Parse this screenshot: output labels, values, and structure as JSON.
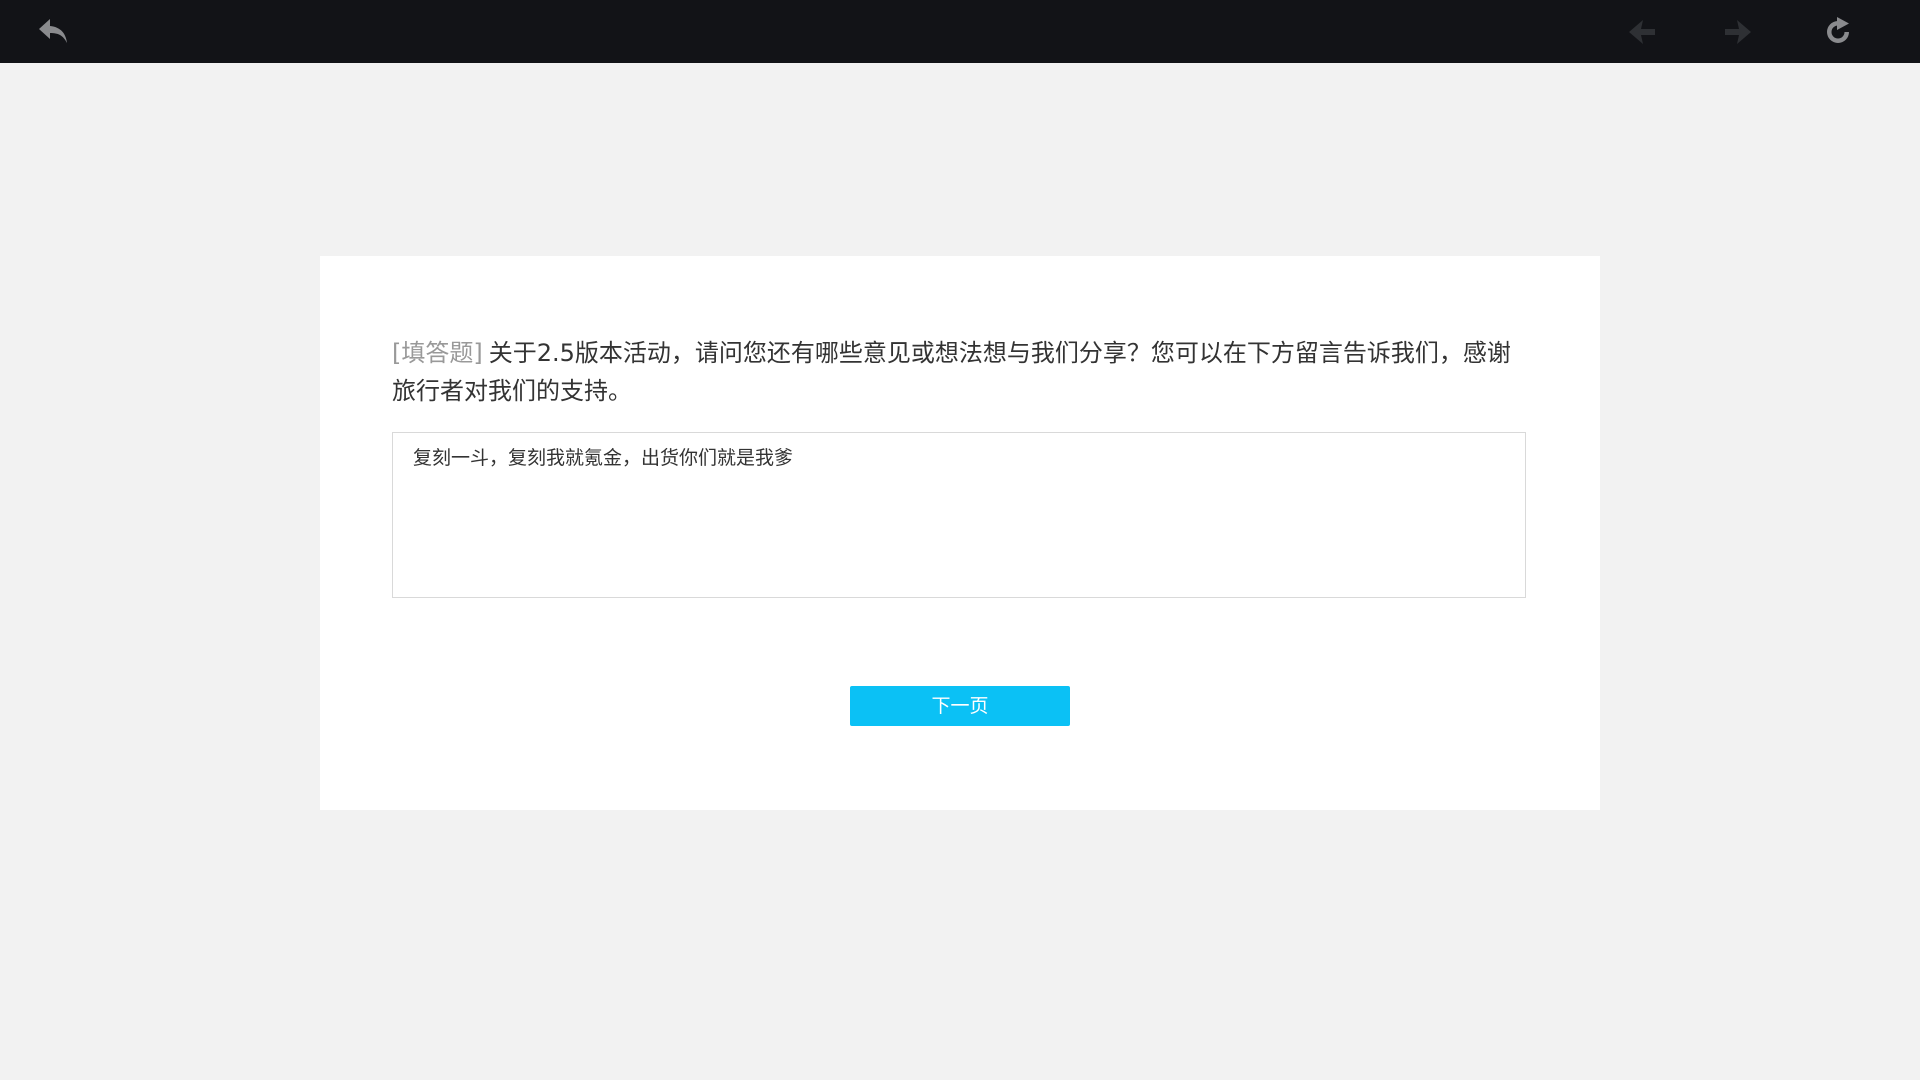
{
  "topbar": {
    "back_icon": "undo-arrow-icon",
    "prev_icon": "arrow-left-icon",
    "next_icon": "arrow-right-icon",
    "refresh_icon": "refresh-icon",
    "colors": {
      "background": "#121317",
      "back_icon": "#8a8b8e",
      "nav_icon_disabled": "#2e3034",
      "refresh_icon": "#8a8b8e"
    }
  },
  "survey": {
    "question_tag": "[填答题]",
    "question_text": "关于2.5版本活动，请问您还有哪些意见或想法想与我们分享？您可以在下方留言告诉我们，感谢旅行者对我们的支持。",
    "answer_value": "复刻一斗，复刻我就氪金，出货你们就是我爹",
    "next_button_label": "下一页"
  },
  "colors": {
    "page_background": "#f2f2f2",
    "card_background": "#ffffff",
    "accent": "#0bc1f5",
    "question_tag": "#999999",
    "text": "#333333"
  }
}
